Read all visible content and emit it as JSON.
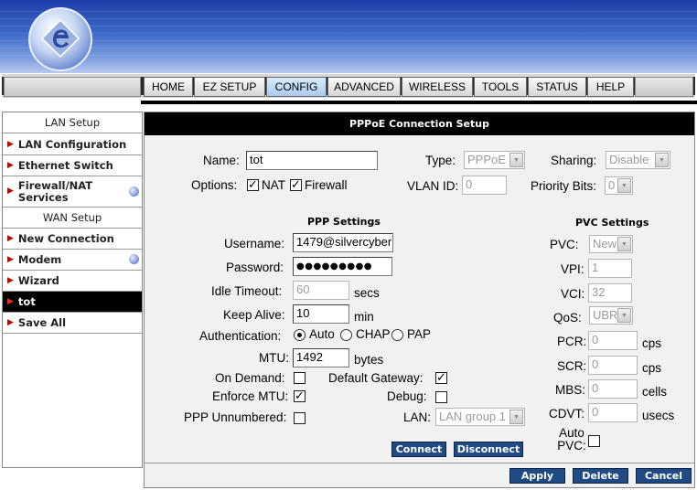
{
  "nav": {
    "tabs": [
      {
        "label": "HOME"
      },
      {
        "label": "EZ SETUP"
      },
      {
        "label": "CONFIG"
      },
      {
        "label": "ADVANCED"
      },
      {
        "label": "WIRELESS"
      },
      {
        "label": "TOOLS"
      },
      {
        "label": "STATUS"
      },
      {
        "label": "HELP"
      }
    ],
    "active": "CONFIG"
  },
  "sidebar": {
    "lan_header": "LAN Setup",
    "lan_items": [
      "LAN Configuration",
      "Ethernet Switch",
      "Firewall/NAT Services"
    ],
    "wan_header": "WAN Setup",
    "wan_items": [
      "New Connection",
      "Modem",
      "Wizard",
      "tot",
      "Save All"
    ],
    "active_item": "tot"
  },
  "panel": {
    "title": "PPPoE Connection Setup",
    "name_label": "Name:",
    "name_value": "tot",
    "type_label": "Type:",
    "type_value": "PPPoE",
    "sharing_label": "Sharing:",
    "sharing_value": "Disable",
    "options_label": "Options:",
    "nat_label": "NAT",
    "nat_checked": true,
    "firewall_label": "Firewall",
    "firewall_checked": true,
    "vlan_label": "VLAN ID:",
    "vlan_value": "0",
    "priority_label": "Priority Bits:",
    "priority_value": "0",
    "ppp": {
      "title": "PPP Settings",
      "username_label": "Username:",
      "username_value": "1479@silvercyber",
      "password_label": "Password:",
      "password_value": "●●●●●●●●●",
      "idle_label": "Idle Timeout:",
      "idle_value": "60",
      "idle_unit": "secs",
      "keepalive_label": "Keep Alive:",
      "keepalive_value": "10",
      "keepalive_unit": "min",
      "auth_label": "Authentication:",
      "auth_options": [
        "Auto",
        "CHAP",
        "PAP"
      ],
      "auth_selected": "Auto",
      "mtu_label": "MTU:",
      "mtu_value": "1492",
      "mtu_unit": "bytes",
      "on_demand_label": "On Demand:",
      "on_demand_checked": false,
      "default_gw_label": "Default Gateway:",
      "default_gw_checked": true,
      "enforce_mtu_label": "Enforce MTU:",
      "enforce_mtu_checked": true,
      "debug_label": "Debug:",
      "debug_checked": false,
      "unnumbered_label": "PPP Unnumbered:",
      "unnumbered_checked": false,
      "lan_label": "LAN:",
      "lan_value": "LAN group 1",
      "connect_label": "Connect",
      "disconnect_label": "Disconnect"
    },
    "pvc": {
      "title": "PVC Settings",
      "pvc_label": "PVC:",
      "pvc_value": "New",
      "vpi_label": "VPI:",
      "vpi_value": "1",
      "vci_label": "VCI:",
      "vci_value": "32",
      "qos_label": "QoS:",
      "qos_value": "UBR",
      "pcr_label": "PCR:",
      "pcr_value": "0",
      "pcr_unit": "cps",
      "scr_label": "SCR:",
      "scr_value": "0",
      "scr_unit": "cps",
      "mbs_label": "MBS:",
      "mbs_value": "0",
      "mbs_unit": "cells",
      "cdvt_label": "CDVT:",
      "cdvt_value": "0",
      "cdvt_unit": "usecs",
      "auto_pvc_label": "Auto PVC:",
      "auto_pvc_checked": false
    },
    "apply_label": "Apply",
    "delete_label": "Delete",
    "cancel_label": "Cancel"
  }
}
